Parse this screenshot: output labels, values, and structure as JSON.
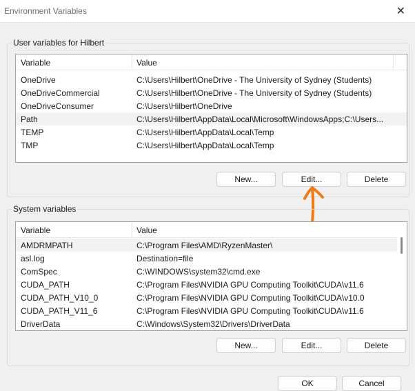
{
  "window": {
    "title": "Environment Variables"
  },
  "user_section": {
    "legend": "User variables for Hilbert",
    "columns": [
      "Variable",
      "Value"
    ],
    "rows": [
      {
        "name": "OneDrive",
        "value": "C:\\Users\\Hilbert\\OneDrive - The University of Sydney (Students)"
      },
      {
        "name": "OneDriveCommercial",
        "value": "C:\\Users\\Hilbert\\OneDrive - The University of Sydney (Students)"
      },
      {
        "name": "OneDriveConsumer",
        "value": "C:\\Users\\Hilbert\\OneDrive"
      },
      {
        "name": "Path",
        "value": "C:\\Users\\Hilbert\\AppData\\Local\\Microsoft\\WindowsApps;C:\\Users..."
      },
      {
        "name": "TEMP",
        "value": "C:\\Users\\Hilbert\\AppData\\Local\\Temp"
      },
      {
        "name": "TMP",
        "value": "C:\\Users\\Hilbert\\AppData\\Local\\Temp"
      }
    ],
    "selected_row": "Path",
    "buttons": {
      "new": "New...",
      "edit": "Edit...",
      "delete": "Delete"
    }
  },
  "system_section": {
    "legend": "System variables",
    "columns": [
      "Variable",
      "Value"
    ],
    "rows": [
      {
        "name": "AMDRMPATH",
        "value": "C:\\Program Files\\AMD\\RyzenMaster\\"
      },
      {
        "name": "asl.log",
        "value": "Destination=file"
      },
      {
        "name": "ComSpec",
        "value": "C:\\WINDOWS\\system32\\cmd.exe"
      },
      {
        "name": "CUDA_PATH",
        "value": "C:\\Program Files\\NVIDIA GPU Computing Toolkit\\CUDA\\v11.6"
      },
      {
        "name": "CUDA_PATH_V10_0",
        "value": "C:\\Program Files\\NVIDIA GPU Computing Toolkit\\CUDA\\v10.0"
      },
      {
        "name": "CUDA_PATH_V11_6",
        "value": "C:\\Program Files\\NVIDIA GPU Computing Toolkit\\CUDA\\v11.6"
      },
      {
        "name": "DriverData",
        "value": "C:\\Windows\\System32\\Drivers\\DriverData"
      }
    ],
    "selected_row": "AMDRMPATH",
    "buttons": {
      "new": "New...",
      "edit": "Edit...",
      "delete": "Delete"
    }
  },
  "dialog_buttons": {
    "ok": "OK",
    "cancel": "Cancel"
  },
  "annotation": {
    "icon": "hand-drawn-up-arrow-icon",
    "color": "#f07b16"
  }
}
